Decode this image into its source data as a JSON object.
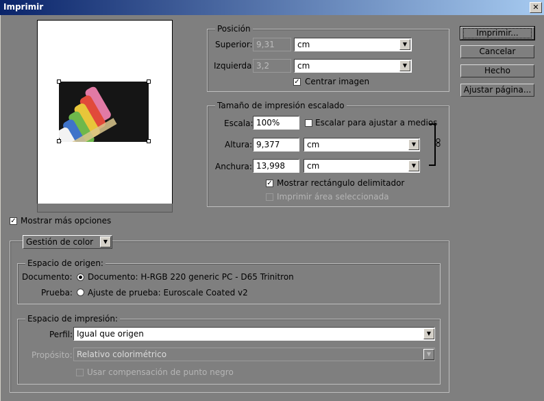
{
  "window": {
    "title": "Imprimir",
    "close_symbol": "✕"
  },
  "position": {
    "legend": "Posición",
    "top_label": "Superior:",
    "top_value": "9,31",
    "top_unit": "cm",
    "left_label": "Izquierda:",
    "left_value": "3,2",
    "left_unit": "cm",
    "center_label": "Centrar imagen",
    "center_checked": true
  },
  "scaled_size": {
    "legend": "Tamaño de impresión escalado",
    "scale_label": "Escala:",
    "scale_value": "100%",
    "fit_media_label": "Escalar para ajustar a medios",
    "fit_media_checked": false,
    "height_label": "Altura:",
    "height_value": "9,377",
    "height_unit": "cm",
    "width_label": "Anchura:",
    "width_value": "13,998",
    "width_unit": "cm",
    "bounding_box_label": "Mostrar rectángulo delimitador",
    "bounding_box_checked": true,
    "print_selected_label": "Imprimir área seleccionada",
    "print_selected_checked": false
  },
  "buttons": {
    "print": "Imprimir...",
    "cancel": "Cancelar",
    "done": "Hecho",
    "page_setup": "Ajustar página..."
  },
  "more_options": {
    "label": "Mostrar más opciones",
    "checked": true
  },
  "color_management": {
    "select_value": "Gestión de color",
    "source_space": {
      "legend": "Espacio de origen:",
      "document_label": "Documento:",
      "document_option": "Documento: H-RGB 220 generic PC - D65 Trinitron",
      "proof_label": "Prueba:",
      "proof_option": "Ajuste de prueba: Euroscale Coated v2"
    },
    "print_space": {
      "legend": "Espacio de impresión:",
      "profile_label": "Perfil:",
      "profile_value": "Igual que origen",
      "intent_label": "Propósito:",
      "intent_value": "Relativo colorimétrico",
      "black_point_label": "Usar compensación de punto negro"
    }
  },
  "icons": {
    "dropdown": "▼",
    "check": "✓",
    "link": "chain-link-icon"
  },
  "colors": {
    "title_start": "#0a246a",
    "title_end": "#a6caf0",
    "dialog_bg": "#7f7f7f"
  }
}
